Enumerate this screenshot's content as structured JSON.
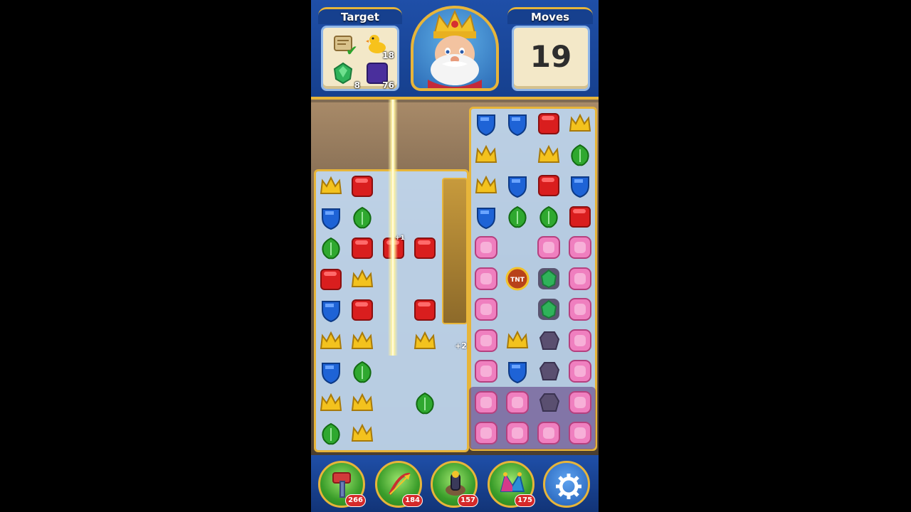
{
  "hud": {
    "target_label": "Target",
    "moves_label": "Moves",
    "moves_value": "19",
    "goals": [
      {
        "name": "scroll",
        "count": "",
        "done": true
      },
      {
        "name": "duck",
        "count": "18",
        "done": false
      },
      {
        "name": "emerald",
        "count": "8",
        "done": false
      },
      {
        "name": "purple-block",
        "count": "76",
        "done": false
      }
    ]
  },
  "booster_badges": {
    "hammer": "266",
    "arrow": "184",
    "cannon": "157",
    "jester_hat": "175"
  },
  "board_tokens": {
    "tnt_label": "TNT",
    "bonus_plus_a": "+1",
    "bonus_plus_b": "+2"
  },
  "colors": {
    "red": "#d91e1e",
    "blue": "#1e63d6",
    "yellow": "#f3c21e",
    "green": "#2fa82f",
    "pink": "#ef7fbf",
    "gold_frame": "#e7b53a",
    "hud_blue": "#1f4fa8"
  }
}
